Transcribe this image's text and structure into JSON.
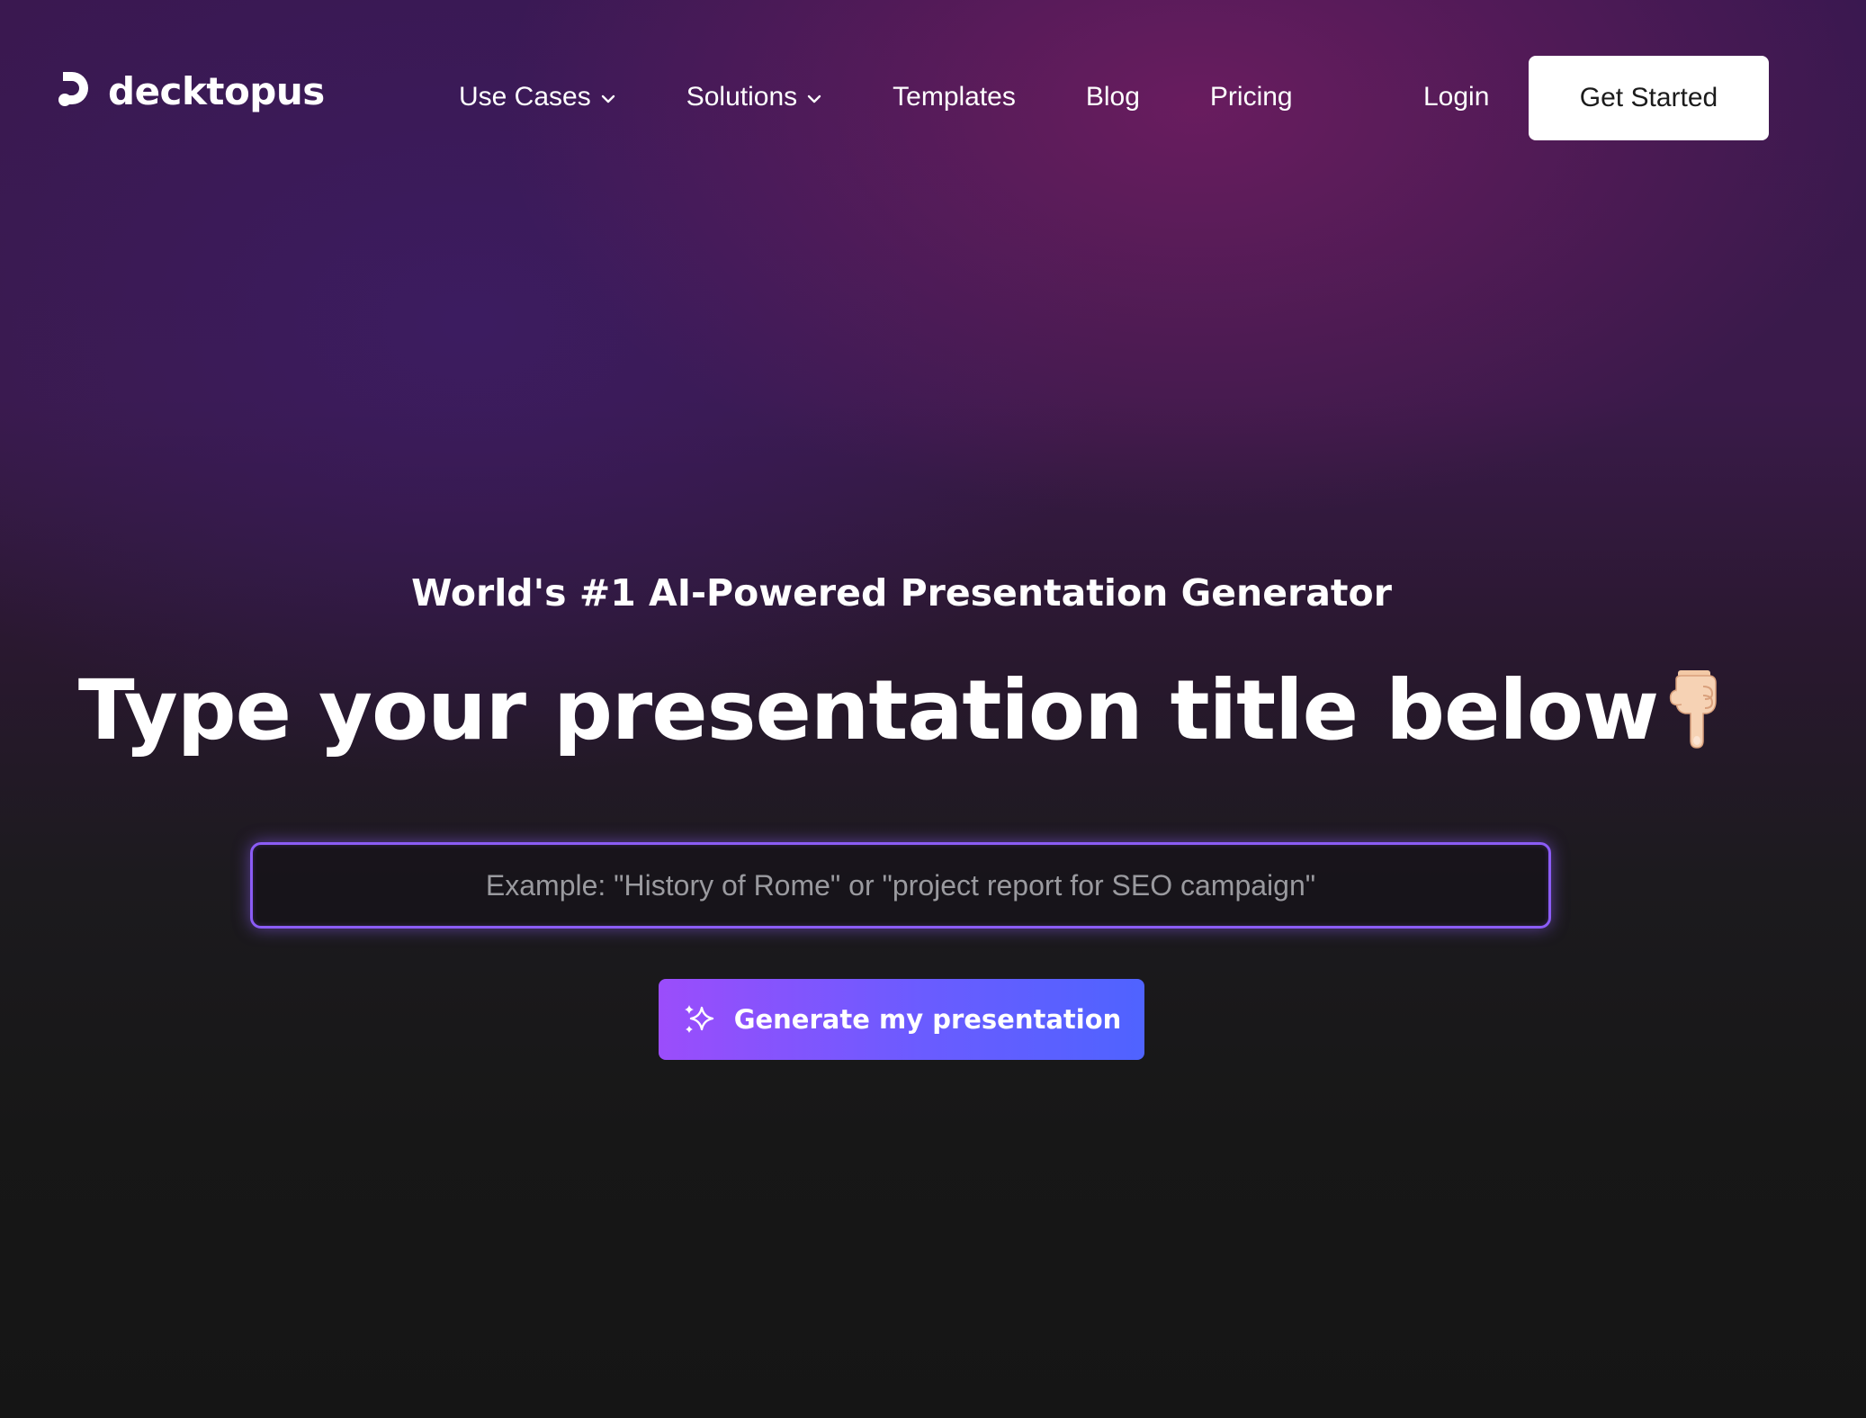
{
  "brand": {
    "name": "decktopus"
  },
  "nav": {
    "items": [
      {
        "label": "Use Cases",
        "has_dropdown": true
      },
      {
        "label": "Solutions",
        "has_dropdown": true
      },
      {
        "label": "Templates",
        "has_dropdown": false
      },
      {
        "label": "Blog",
        "has_dropdown": false
      },
      {
        "label": "Pricing",
        "has_dropdown": false
      }
    ],
    "login_label": "Login",
    "cta_label": "Get Started"
  },
  "hero": {
    "subtitle": "World's #1 AI-Powered Presentation Generator",
    "headline": "Type your presentation title below",
    "headline_emoji_icon": "pointing-down-hand-icon",
    "input": {
      "value": "",
      "placeholder": "Example: \"History of Rome\" or \"project report for SEO campaign\""
    },
    "generate_label": "Generate my presentation",
    "generate_icon": "sparkles-icon"
  },
  "colors": {
    "accent_purple": "#8b5cf6",
    "button_gradient_start": "#9b4dfb",
    "button_gradient_end": "#4f63ff",
    "cta_background": "#ffffff",
    "page_background": "#171717"
  }
}
